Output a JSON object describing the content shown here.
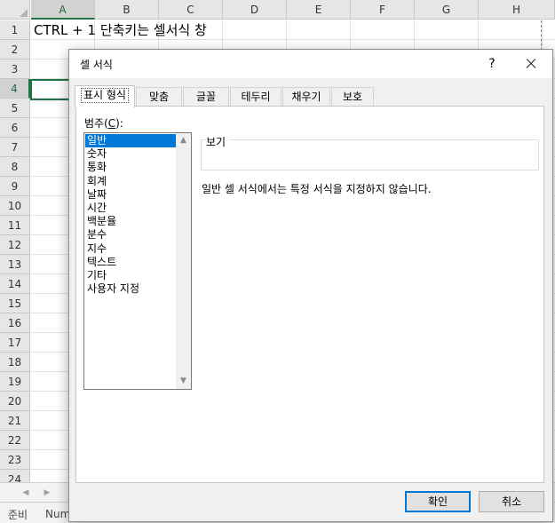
{
  "sheet": {
    "columns": [
      "A",
      "B",
      "C",
      "D",
      "E",
      "F",
      "G",
      "H"
    ],
    "rows": [
      "1",
      "2",
      "3",
      "4",
      "5",
      "6",
      "7",
      "8",
      "9",
      "10",
      "11",
      "12",
      "13",
      "14",
      "15",
      "16",
      "17",
      "18",
      "19",
      "20",
      "21",
      "22",
      "23",
      "24"
    ],
    "active_column": "A",
    "active_row": "4",
    "cell_a1": "CTRL + 1 단축키는 셀서식 창"
  },
  "sheet_tabs": {
    "prev_icon": "triangle-left-icon",
    "next_icon": "triangle-right-icon"
  },
  "status": {
    "ready": "준비",
    "num": "Num"
  },
  "dialog": {
    "title": "셀 서식",
    "help_label": "?",
    "tabs": [
      "표시 형식",
      "맞춤",
      "글꼴",
      "테두리",
      "채우기",
      "보호"
    ],
    "selected_tab": "표시 형식",
    "category_label_prefix": "범주(",
    "category_label_key": "C",
    "category_label_suffix": "):",
    "categories": [
      "일반",
      "숫자",
      "통화",
      "회계",
      "날짜",
      "시간",
      "백분율",
      "분수",
      "지수",
      "텍스트",
      "기타",
      "사용자 지정"
    ],
    "selected_category": "일반",
    "sample_label": "보기",
    "description": "일반 셀 서식에서는 특정 서식을 지정하지 않습니다.",
    "ok_label": "확인",
    "cancel_label": "취소"
  },
  "colors": {
    "accent_green": "#217346",
    "selection_blue": "#0078d7"
  }
}
